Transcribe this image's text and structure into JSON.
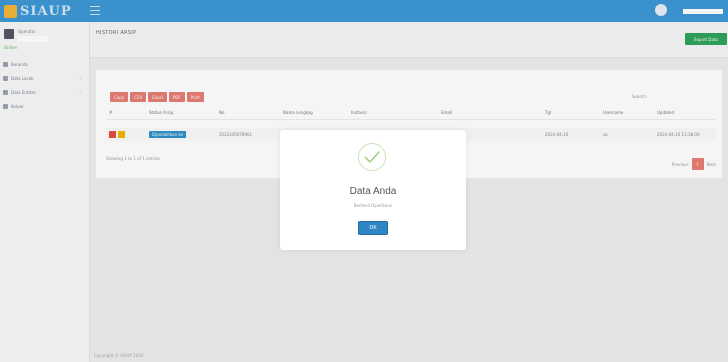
{
  "app": {
    "logo_text": "SIAUP"
  },
  "topbar": {
    "user_label": ""
  },
  "sidebar": {
    "user_name": "Operator",
    "status": "Online",
    "items": [
      {
        "label": "Beranda",
        "has_children": false,
        "icon": "home-icon"
      },
      {
        "label": "Data Lacak",
        "has_children": true,
        "icon": "database-icon"
      },
      {
        "label": "Data Entitas",
        "has_children": true,
        "icon": "users-icon"
      },
      {
        "label": "Keluar",
        "has_children": false,
        "icon": "logout-icon"
      }
    ]
  },
  "header": {
    "title": "HISTORI ARSIP",
    "export_label": "Export Data"
  },
  "table": {
    "buttons": [
      "Copy",
      "CSV",
      "Excel",
      "PDF",
      "Print"
    ],
    "search_label": "Search:",
    "columns": [
      "#",
      "Status Arsip",
      "No",
      "Nama Lengkap",
      "Instansi",
      "Email",
      "Tgl",
      "Username",
      "Updated"
    ],
    "rows": [
      {
        "status": "Dipindahkan ke",
        "no": "3522345678901",
        "nama": "",
        "instansi": "",
        "email": "",
        "tgl": "2024-04-26",
        "username": "sa",
        "updated": "2024-04-26 13:38:00"
      }
    ],
    "showing": "Showing 1 to 1 of 1 entries",
    "prev": "Previous",
    "page": "1",
    "next": "Next"
  },
  "modal": {
    "title": "Data Anda",
    "text": "Berhasil Diperbarui",
    "ok_label": "OK"
  },
  "footer": {
    "text": "Copyright © SIAUP 2024"
  },
  "colors": {
    "topbar": "#3d97d4",
    "danger": "#e77d73",
    "success": "#2fa35a",
    "primary": "#2d85c4"
  }
}
